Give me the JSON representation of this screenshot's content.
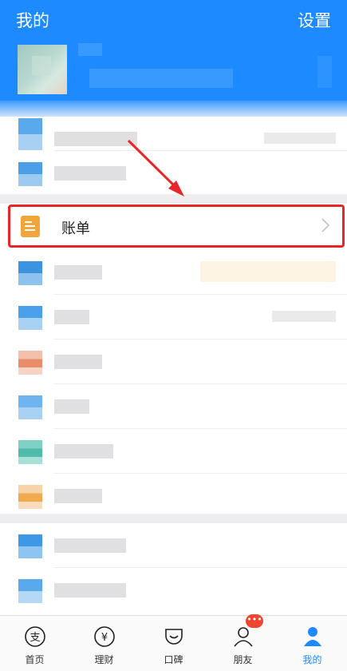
{
  "header": {
    "title": "我的",
    "settings": "设置"
  },
  "bill_row": {
    "label": "账单"
  },
  "tabs": [
    {
      "label": "首页",
      "icon": "alipay-icon"
    },
    {
      "label": "理财",
      "icon": "yuan-icon"
    },
    {
      "label": "口碑",
      "icon": "koubei-icon"
    },
    {
      "label": "朋友",
      "icon": "friends-icon",
      "badge": "•••"
    },
    {
      "label": "我的",
      "icon": "profile-icon",
      "active": true
    }
  ],
  "colors": {
    "brand": "#1d8bff",
    "highlight": "#e8262a",
    "bill_icon": "#f2a53a"
  }
}
